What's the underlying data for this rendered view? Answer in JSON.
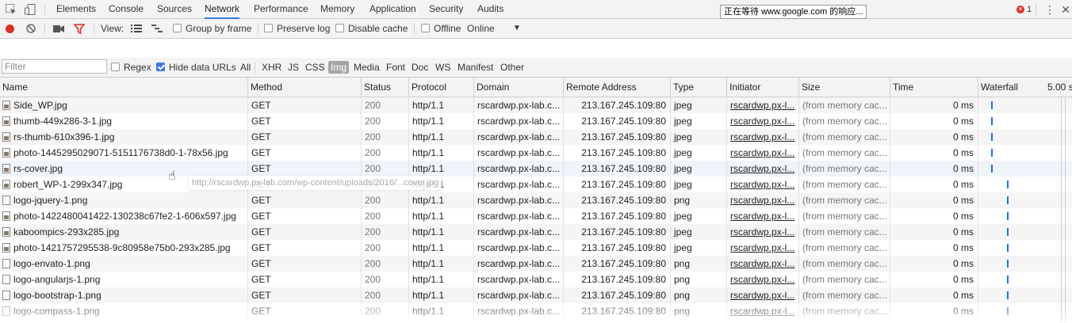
{
  "tooltip": "正在等待 www.google.com 的响应...",
  "tabs": [
    {
      "label": "Elements",
      "active": false
    },
    {
      "label": "Console",
      "active": false
    },
    {
      "label": "Sources",
      "active": false
    },
    {
      "label": "Network",
      "active": true
    },
    {
      "label": "Performance",
      "active": false
    },
    {
      "label": "Memory",
      "active": false
    },
    {
      "label": "Application",
      "active": false
    },
    {
      "label": "Security",
      "active": false
    },
    {
      "label": "Audits",
      "active": false
    }
  ],
  "error_count": "1",
  "toolbar": {
    "view_label": "View:",
    "group_by_frame": "Group by frame",
    "preserve_log": "Preserve log",
    "disable_cache": "Disable cache",
    "offline": "Offline",
    "throttle_value": "Online",
    "record_icon": "record-icon",
    "clear_icon": "clear-icon",
    "camera_icon": "camera-icon",
    "filter_icon": "filter-icon"
  },
  "filterbar": {
    "placeholder": "Filter",
    "regex": "Regex",
    "hide_data_urls": "Hide data URLs",
    "types": [
      "All",
      "XHR",
      "JS",
      "CSS",
      "Img",
      "Media",
      "Font",
      "Doc",
      "WS",
      "Manifest",
      "Other"
    ],
    "selected_type": "Img"
  },
  "columns": [
    "Name",
    "Method",
    "Status",
    "Protocol",
    "Domain",
    "Remote Address",
    "Type",
    "Initiator",
    "Size",
    "Time",
    "Waterfall"
  ],
  "waterfall_scale": "5.00 s",
  "hover_url": "http://rscardwp.px-lab.com/wp-content/uploads/2016/...cover.jpg",
  "rows": [
    {
      "name": "Side_WP.jpg",
      "method": "GET",
      "status": "200",
      "protocol": "http/1.1",
      "domain": "rscardwp.px-lab.c...",
      "remote": "213.167.245.109:80",
      "type": "jpeg",
      "initiator": "rscardwp.px-l...",
      "size": "(from memory cac...",
      "time": "0 ms",
      "w": 0.0
    },
    {
      "name": "thumb-449x286-3-1.jpg",
      "method": "GET",
      "status": "200",
      "protocol": "http/1.1",
      "domain": "rscardwp.px-lab.c...",
      "remote": "213.167.245.109:80",
      "type": "jpeg",
      "initiator": "rscardwp.px-l...",
      "size": "(from memory cac...",
      "time": "0 ms",
      "w": 0.0
    },
    {
      "name": "rs-thumb-610x396-1.jpg",
      "method": "GET",
      "status": "200",
      "protocol": "http/1.1",
      "domain": "rscardwp.px-lab.c...",
      "remote": "213.167.245.109:80",
      "type": "jpeg",
      "initiator": "rscardwp.px-l...",
      "size": "(from memory cac...",
      "time": "0 ms",
      "w": 0.0
    },
    {
      "name": "photo-1445295029071-5151176738d0-1-78x56.jpg",
      "method": "GET",
      "status": "200",
      "protocol": "http/1.1",
      "domain": "rscardwp.px-lab.c...",
      "remote": "213.167.245.109:80",
      "type": "jpeg",
      "initiator": "rscardwp.px-l...",
      "size": "(from memory cac...",
      "time": "0 ms",
      "w": 0.0
    },
    {
      "name": "rs-cover.jpg",
      "method": "GET",
      "status": "200",
      "protocol": "http/1.1",
      "domain": "rscardwp.px-lab.c...",
      "remote": "213.167.245.109:80",
      "type": "jpeg",
      "initiator": "rscardwp.px-l...",
      "size": "(from memory cac...",
      "time": "0 ms",
      "w": 0.0
    },
    {
      "name": "robert_WP-1-299x347.jpg",
      "method": "GET",
      "status": "200",
      "protocol": "http/1.1",
      "domain": "rscardwp.px-lab.c...",
      "remote": "213.167.245.109:80",
      "type": "jpeg",
      "initiator": "rscardwp.px-l...",
      "size": "(from memory cac...",
      "time": "0 ms",
      "w": 0.2
    },
    {
      "name": "logo-jquery-1.png",
      "method": "GET",
      "status": "200",
      "protocol": "http/1.1",
      "domain": "rscardwp.px-lab.c...",
      "remote": "213.167.245.109:80",
      "type": "png",
      "initiator": "rscardwp.px-l...",
      "size": "(from memory cac...",
      "time": "0 ms",
      "w": 0.2
    },
    {
      "name": "photo-1422480041422-130238c67fe2-1-606x597.jpg",
      "method": "GET",
      "status": "200",
      "protocol": "http/1.1",
      "domain": "rscardwp.px-lab.c...",
      "remote": "213.167.245.109:80",
      "type": "jpeg",
      "initiator": "rscardwp.px-l...",
      "size": "(from memory cac...",
      "time": "0 ms",
      "w": 0.2
    },
    {
      "name": "kaboompics-293x285.jpg",
      "method": "GET",
      "status": "200",
      "protocol": "http/1.1",
      "domain": "rscardwp.px-lab.c...",
      "remote": "213.167.245.109:80",
      "type": "jpeg",
      "initiator": "rscardwp.px-l...",
      "size": "(from memory cac...",
      "time": "0 ms",
      "w": 0.2
    },
    {
      "name": "photo-1421757295538-9c80958e75b0-293x285.jpg",
      "method": "GET",
      "status": "200",
      "protocol": "http/1.1",
      "domain": "rscardwp.px-lab.c...",
      "remote": "213.167.245.109:80",
      "type": "jpeg",
      "initiator": "rscardwp.px-l...",
      "size": "(from memory cac...",
      "time": "0 ms",
      "w": 0.2
    },
    {
      "name": "logo-envato-1.png",
      "method": "GET",
      "status": "200",
      "protocol": "http/1.1",
      "domain": "rscardwp.px-lab.c...",
      "remote": "213.167.245.109:80",
      "type": "png",
      "initiator": "rscardwp.px-l...",
      "size": "(from memory cac...",
      "time": "0 ms",
      "w": 0.2
    },
    {
      "name": "logo-angularjs-1.png",
      "method": "GET",
      "status": "200",
      "protocol": "http/1.1",
      "domain": "rscardwp.px-lab.c...",
      "remote": "213.167.245.109:80",
      "type": "png",
      "initiator": "rscardwp.px-l...",
      "size": "(from memory cac...",
      "time": "0 ms",
      "w": 0.2
    },
    {
      "name": "logo-bootstrap-1.png",
      "method": "GET",
      "status": "200",
      "protocol": "http/1.1",
      "domain": "rscardwp.px-lab.c...",
      "remote": "213.167.245.109:80",
      "type": "png",
      "initiator": "rscardwp.px-l...",
      "size": "(from memory cac...",
      "time": "0 ms",
      "w": 0.2
    },
    {
      "name": "logo-compass-1.png",
      "method": "GET",
      "status": "200",
      "protocol": "http/1.1",
      "domain": "rscardwp.px-lab.c...",
      "remote": "213.167.245.109:80",
      "type": "png",
      "initiator": "rscardwp.px-l...",
      "size": "(from memory cac...",
      "time": "0 ms",
      "w": 0.2
    }
  ]
}
